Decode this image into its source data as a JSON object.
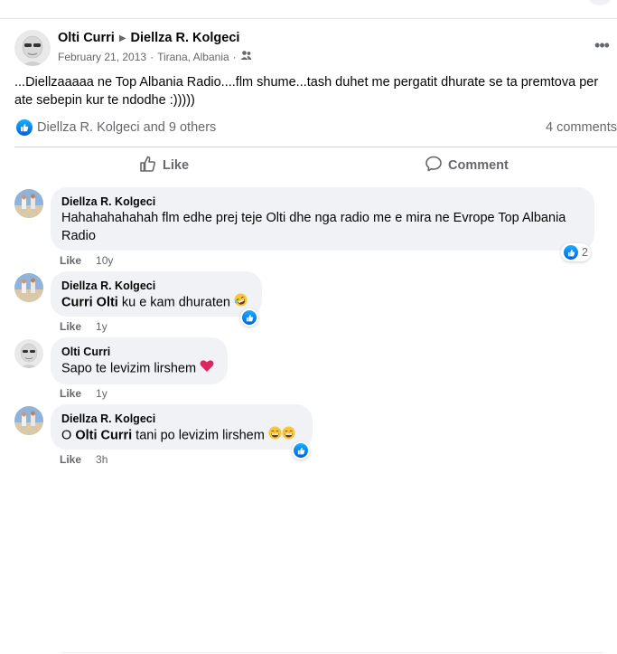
{
  "post": {
    "author": "Olti Curri",
    "target": "Diellza R. Kolgeci",
    "date": "February 21, 2013",
    "location": "Tirana, Albania",
    "text": "...Diellzaaaaa ne Top Albania Radio....flm shume...tash duhet me pergatit dhurate se ta premtova per ate sebepin kur te ndodhe :)))))",
    "reactions_text": "Diellza R. Kolgeci and 9 others",
    "comments_count": "4 comments",
    "like_label": "Like",
    "comment_label": "Comment"
  },
  "comments": [
    {
      "author": "Diellza R. Kolgeci",
      "text": "Hahahahahahah flm edhe prej teje Olti dhe nga radio me e mira ne Evrope Top Albania Radio",
      "like": "Like",
      "time": "10y",
      "reaction_count": "2"
    },
    {
      "author": "Diellza R. Kolgeci",
      "mention": "Curri Olti",
      "text": " ku e kam dhuraten",
      "like": "Like",
      "time": "1y"
    },
    {
      "author": "Olti Curri",
      "text": "Sapo te levizim lirshem",
      "like": "Like",
      "time": "1y"
    },
    {
      "author": "Diellza R. Kolgeci",
      "prefix": "O ",
      "mention": "Olti Curri",
      "text": " tani po levizim lirshem",
      "like": "Like",
      "time": "3h"
    }
  ],
  "colors": {
    "accent": "#0866FF",
    "bubble": "#F0F2F5",
    "secondary_text": "#65676B"
  },
  "icons": [
    "more-icon",
    "friends-icon",
    "like-reaction-icon",
    "like-icon",
    "comment-icon",
    "heart-emoji",
    "rofl-emoji",
    "grin-emoji"
  ]
}
